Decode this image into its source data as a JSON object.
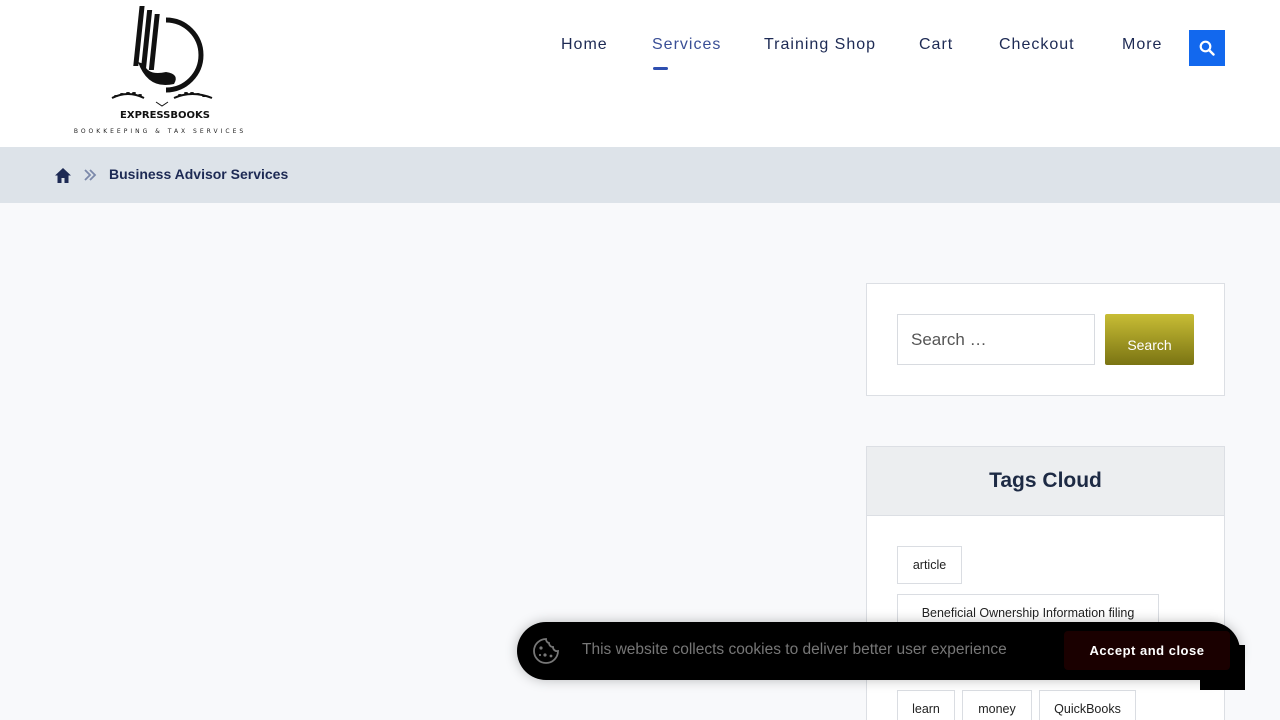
{
  "header": {
    "logo": {
      "name": "EXPRESSBOOKS",
      "tagline": "BOOKKEEPING & TAX SERVICES"
    },
    "nav": [
      {
        "label": "Home"
      },
      {
        "label": "Services",
        "active": true
      },
      {
        "label": "Training Shop"
      },
      {
        "label": "Cart"
      },
      {
        "label": "Checkout"
      },
      {
        "label": "More"
      }
    ],
    "search_icon": "search-icon"
  },
  "breadcrumb": {
    "home_icon": "home-icon",
    "separator_icon": "double-chevron-right-icon",
    "current": "Business Advisor Services"
  },
  "sidebar": {
    "search": {
      "placeholder": "Search …",
      "button_label": "Search"
    },
    "tags": {
      "title": "Tags Cloud",
      "items": [
        "article",
        "Beneficial Ownership Information filing",
        "learn",
        "money",
        "QuickBooks"
      ]
    }
  },
  "cookie_banner": {
    "icon": "cookie-icon",
    "text": "This website collects cookies to deliver better user experience",
    "accept_label": "Accept and close"
  },
  "colors": {
    "accent_blue": "#1268ee",
    "nav_text": "#1d2a54",
    "breadcrumb_bg": "#dde3e9",
    "search_button_gold": "#a69c22"
  }
}
